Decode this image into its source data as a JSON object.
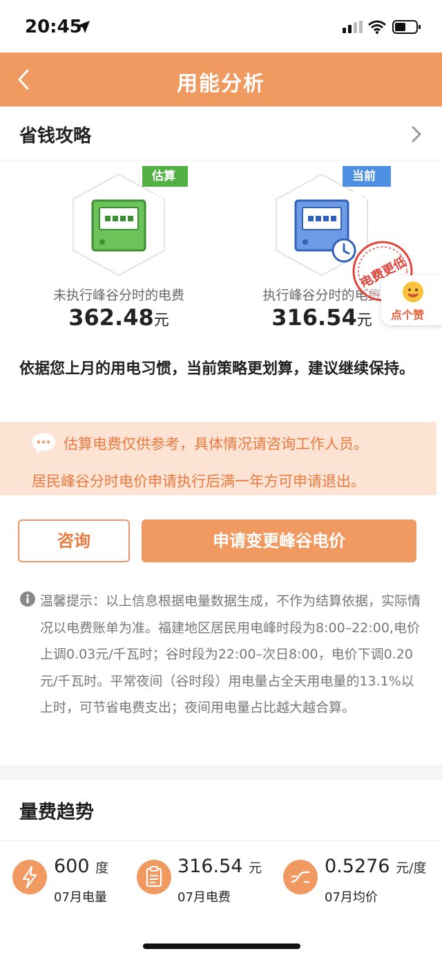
{
  "status": {
    "time": "20:45"
  },
  "nav": {
    "title": "用能分析"
  },
  "guide": {
    "title": "省钱攻略"
  },
  "cards": [
    {
      "ribbon": "估算电费",
      "label": "未执行峰谷分时的电费",
      "value": "362.48",
      "unit": "元"
    },
    {
      "ribbon": "当前策略",
      "label": "执行峰谷分时的电费",
      "value": "316.54",
      "unit": "元"
    }
  ],
  "stamp": {
    "text": "电费更低"
  },
  "like": {
    "label": "点个赞"
  },
  "advice": "依据您上月的用电习惯，当前策略更划算，建议继续保持。",
  "notice": {
    "line1": "估算电费仅供参考，具体情况请咨询工作人员。",
    "line2": "居民峰谷分时电价申请执行后满一年方可申请退出。"
  },
  "buttons": {
    "consult": "咨询",
    "apply": "申请变更峰谷电价"
  },
  "tip": "温馨提示：以上信息根据电量数据生成，不作为结算依据，实际情况以电费账单为准。福建地区居民用电峰时段为8:00–22:00,电价上调0.03元/千瓦时；谷时段为22:00–次日8:00，电价下调0.20元/千瓦时。平常夜间（谷时段）用电量占全天用电量的13.1%以上时，可节省电费支出；夜间用电量占比越大越合算。",
  "trend": {
    "title": "量费趋势",
    "stats": [
      {
        "value": "600",
        "unit": "度",
        "label": "07月电量"
      },
      {
        "value": "316.54",
        "unit": "元",
        "label": "07月电费"
      },
      {
        "value": "0.5276",
        "unit": "元/度",
        "label": "07月均价"
      }
    ]
  },
  "colors": {
    "brand": "#f09a62",
    "accent_text": "#ea7a40",
    "green": "#52b045",
    "blue": "#4d8fe0",
    "stamp": "#e0443a"
  }
}
